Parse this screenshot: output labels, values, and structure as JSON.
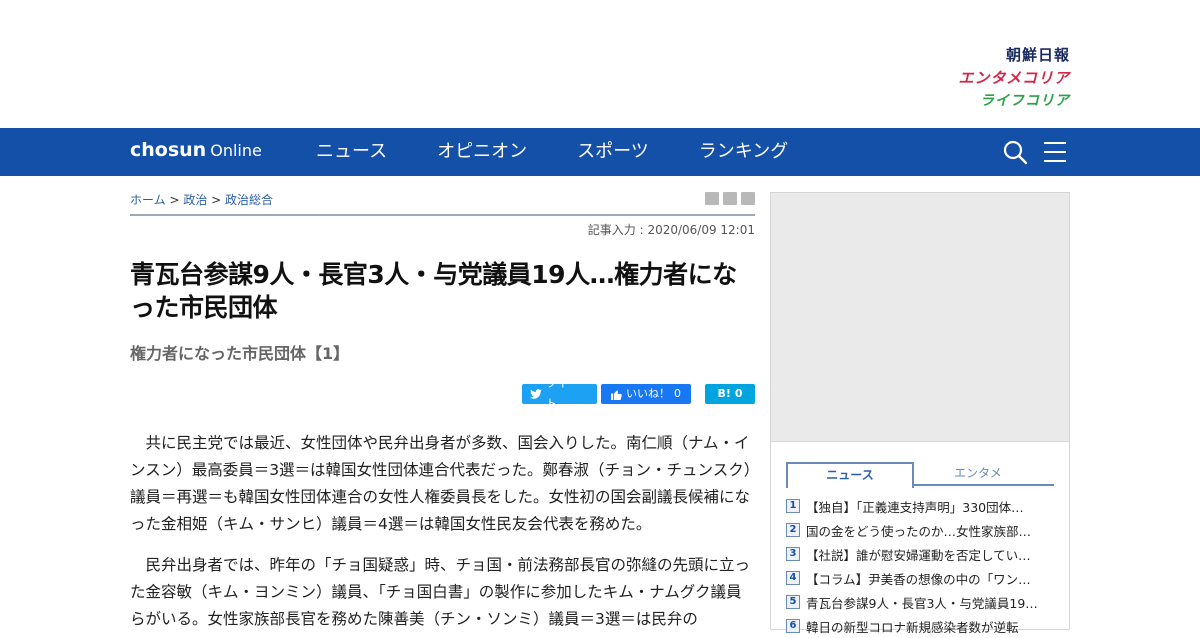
{
  "brands": {
    "chosun": "朝鮮日報",
    "enta": "エンタメコリア",
    "life": "ライフコリア"
  },
  "nav": {
    "logo_main": "chosun",
    "logo_sub": "Online",
    "items": [
      "ニュース",
      "オピニオン",
      "スポーツ",
      "ランキング"
    ]
  },
  "breadcrumb": {
    "home": "ホーム",
    "sep1": " > ",
    "cat": "政治",
    "sep2": " > ",
    "sub": "政治総合"
  },
  "article": {
    "date": "記事入力 : 2020/06/09 12:01",
    "headline": "青瓦台参謀9人・長官3人・与党議員19人…権力者になった市民団体",
    "subhead": "権力者になった市民団体【1】",
    "share": {
      "tweet": "ツイート",
      "like": "いいね！",
      "like_count": "0",
      "hatena": "B!",
      "hatena_count": "0"
    },
    "paragraphs": [
      "共に民主党では最近、女性団体や民弁出身者が多数、国会入りした。南仁順（ナム・インスン）最高委員＝3選＝は韓国女性団体連合代表だった。鄭春淑（チョン・チュンスク）議員＝再選＝も韓国女性団体連合の女性人権委員長をした。女性初の国会副議長候補になった金相姫（キム・サンヒ）議員＝4選＝は韓国女性民友会代表を務めた。",
      "民弁出身者では、昨年の「チョ国疑惑」時、チョ国・前法務部長官の弥縫の先頭に立った金容敏（キム・ヨンミン）議員、「チョ国白書」の製作に参加したキム・ナムグク議員らがいる。女性家族部長官を務めた陳善美（チン・ソンミ）議員＝3選＝は民弁の"
    ]
  },
  "sidebar": {
    "tabs": [
      "ニュース",
      "エンタメ"
    ],
    "ranking": [
      {
        "num": "1",
        "title": "【独自】「正義連支持声明」330団体…"
      },
      {
        "num": "2",
        "title": "国の金をどう使ったのか…女性家族部…"
      },
      {
        "num": "3",
        "title": "【社説】誰が慰安婦運動を否定してい…"
      },
      {
        "num": "4",
        "title": "【コラム】尹美香の想像の中の「ワン…"
      },
      {
        "num": "5",
        "title": "青瓦台参謀9人・長官3人・与党議員19…"
      },
      {
        "num": "6",
        "title": "韓日の新型コロナ新規感染者数が逆転"
      }
    ]
  },
  "colors": {
    "nav_bg": "#1550a8",
    "enta_brand": "#d0284a",
    "life_brand": "#2aa04a",
    "twitter": "#1da1f2",
    "facebook": "#1877f2",
    "hatena": "#00a4de"
  }
}
